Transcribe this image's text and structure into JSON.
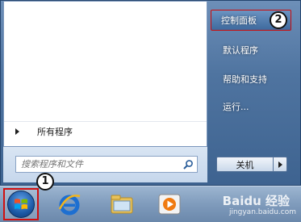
{
  "start_menu": {
    "all_programs": "所有程序",
    "search_placeholder": "搜索程序和文件",
    "right_items": [
      "控制面板",
      "默认程序",
      "帮助和支持",
      "运行..."
    ],
    "shutdown_label": "关机"
  },
  "annotations": {
    "badge_1": "1",
    "badge_2": "2"
  },
  "watermark": {
    "brand": "Baidu 经验",
    "url": "jingyan.baidu.com"
  },
  "colors": {
    "highlight_border": "#cc0a0a",
    "menu_blue": "#4f74a0"
  }
}
